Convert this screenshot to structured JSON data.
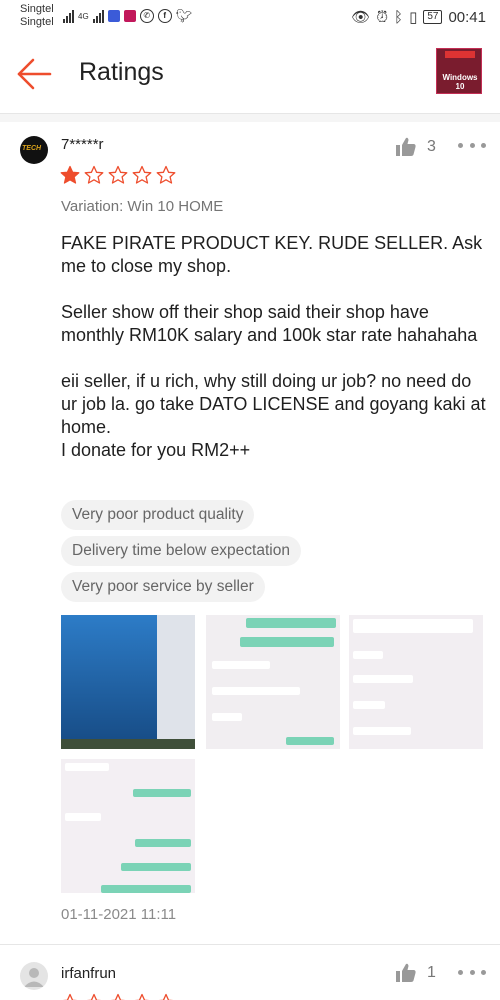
{
  "status_bar": {
    "carrier_1": "Singtel",
    "carrier_2": "Singtel",
    "network": "4G",
    "battery": "57",
    "time": "00:41"
  },
  "header": {
    "title": "Ratings",
    "product_thumb_text": "Windows 10"
  },
  "review": {
    "username": "7*****r",
    "likes": "3",
    "rating": 1,
    "max_rating": 5,
    "variation": "Variation: Win 10 HOME",
    "text_paragraphs": [
      "FAKE PIRATE PRODUCT KEY. RUDE SELLER. Ask me to close my shop.",
      "Seller show off their shop said their shop have monthly RM10K salary and 100k star rate hahahaha",
      "eii seller, if u rich, why still doing ur job? no need do ur job la. go take DATO LICENSE and goyang kaki at home.\nI donate for you RM2++"
    ],
    "tags": [
      "Very poor product quality",
      "Delivery time below expectation",
      "Very poor service by seller"
    ],
    "photo_count": 4,
    "date": "01-11-2021 11:11"
  },
  "next_review": {
    "username": "irfanfrun",
    "likes": "1"
  },
  "colors": {
    "accent": "#ee4d2d",
    "star": "#ee4d2d",
    "muted_text": "#757575",
    "tag_bg": "#f2f2f2"
  }
}
